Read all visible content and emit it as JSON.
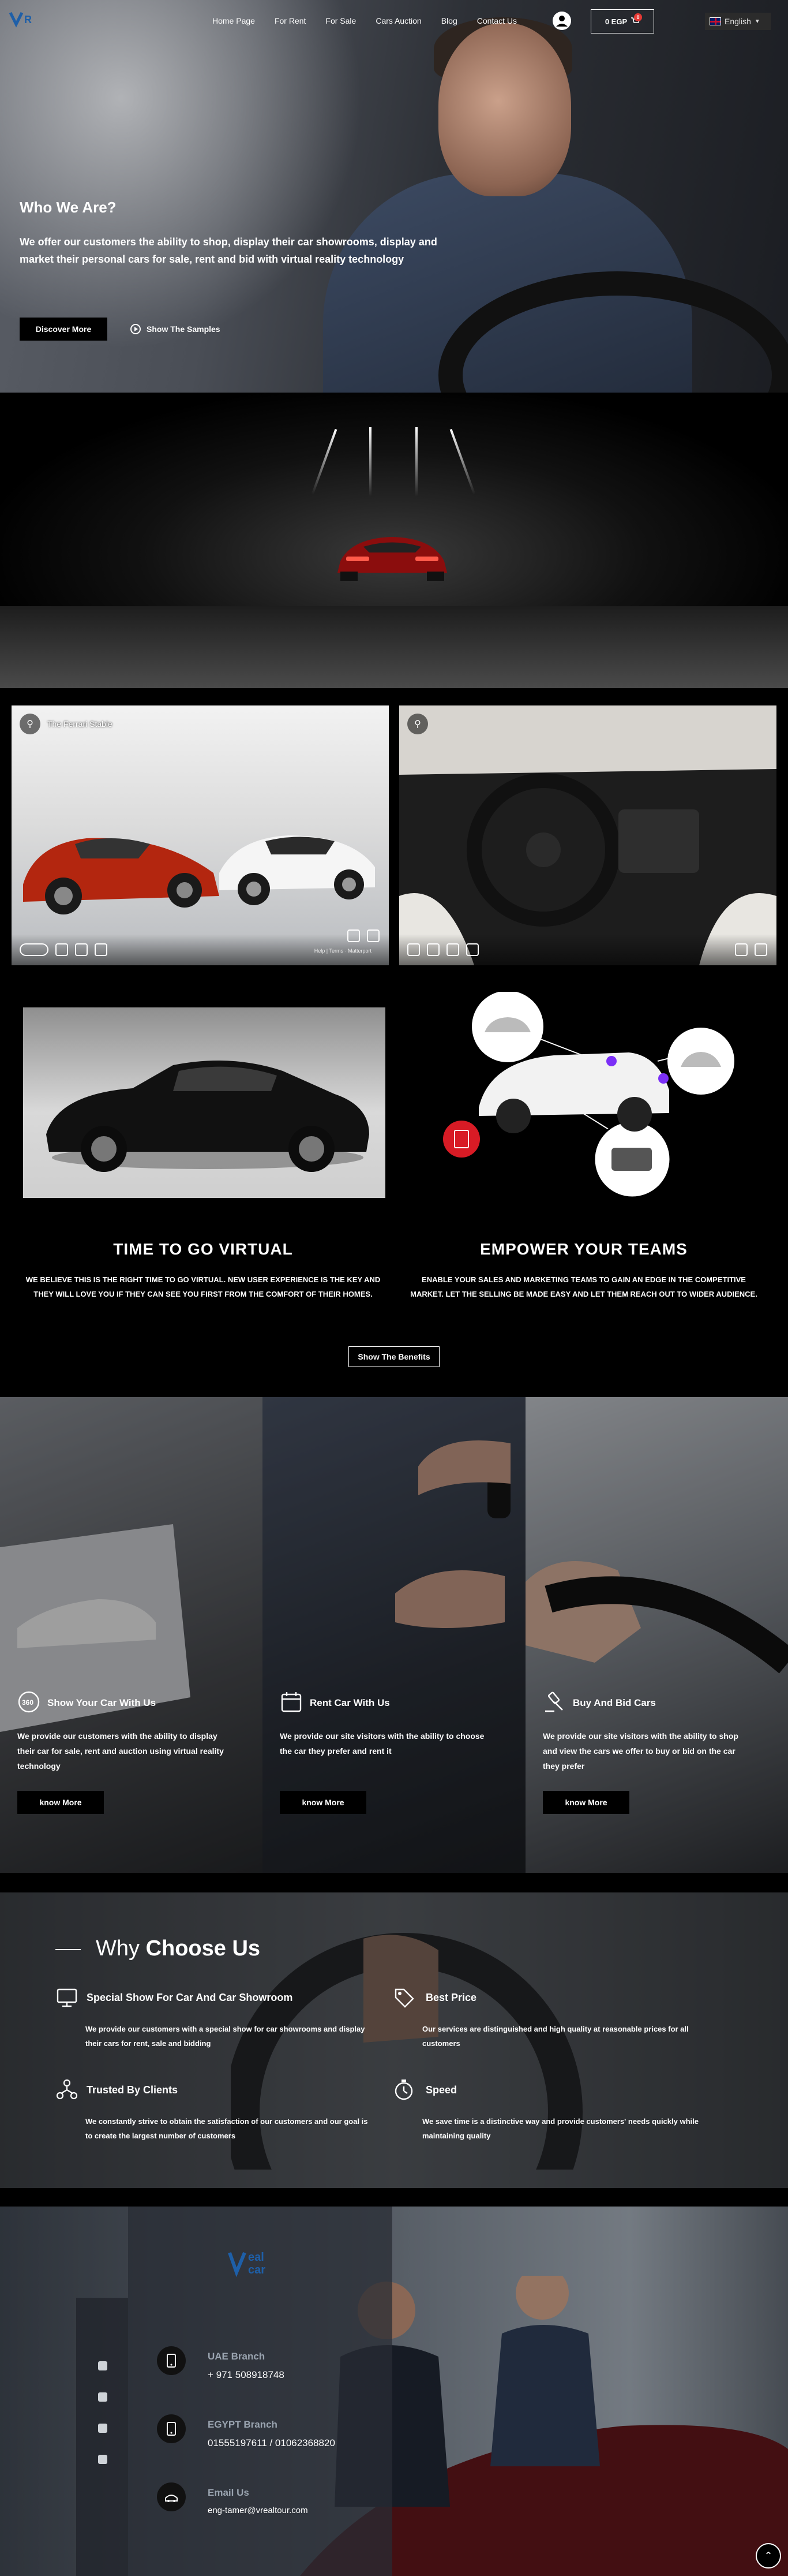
{
  "nav": {
    "links": [
      "Home Page",
      "For Rent",
      "For Sale",
      "Cars Auction",
      "Blog",
      "Contact Us"
    ],
    "cart_label": "0 EGP",
    "cart_count": "0",
    "language": "English"
  },
  "hero": {
    "title": "Who We Are?",
    "text": "We offer our customers the ability to shop, display their car showrooms, display and market their personal cars for sale, rent and bid with virtual reality technology",
    "discover_label": "Discover More",
    "samples_label": "Show The Samples"
  },
  "tours": [
    {
      "title": "The Ferrari Stable",
      "credit": "Help | Terms",
      "brand": "Matterport"
    },
    {
      "title": "",
      "credit": "",
      "brand": ""
    }
  ],
  "virtual": {
    "left_title": "TIME TO GO VIRTUAL",
    "left_text": "WE BELIEVE THIS IS THE RIGHT TIME TO GO VIRTUAL. NEW USER EXPERIENCE IS THE KEY AND THEY WILL LOVE YOU IF THEY CAN SEE YOU FIRST FROM THE COMFORT OF THEIR HOMES.",
    "right_title": "EMPOWER YOUR TEAMS",
    "right_text": "ENABLE YOUR SALES AND MARKETING TEAMS TO GAIN AN EDGE IN THE COMPETITIVE MARKET. LET THE SELLING BE MADE EASY AND LET THEM REACH OUT TO WIDER AUDIENCE.",
    "benefits_label": "Show The Benefits"
  },
  "services": [
    {
      "title": "Show Your Car With Us",
      "text": "We provide our customers with the ability to display their car for sale, rent and auction using virtual reality technology",
      "button": "know More",
      "icon": "360-icon"
    },
    {
      "title": "Rent Car With Us",
      "text": "We provide our site visitors with the ability to choose the car they prefer and rent it",
      "button": "know More",
      "icon": "calendar-icon"
    },
    {
      "title": "Buy And Bid Cars",
      "text": "We provide our site visitors with the ability to shop and view the cars we offer to buy or bid on the car they prefer",
      "button": "know More",
      "icon": "auction-icon"
    }
  ],
  "why": {
    "title_light": "Why ",
    "title_bold": "Choose Us",
    "items": [
      {
        "title": "Special Show For Car And Car Showroom",
        "text": "We provide our customers with a special show for car showrooms and display their cars for rent, sale and bidding"
      },
      {
        "title": "Best Price",
        "text": "Our services are distinguished and high quality at reasonable prices for all customers"
      },
      {
        "title": "Trusted By Clients",
        "text": "We constantly strive to obtain the satisfaction of our customers and our goal is to create the largest number of customers"
      },
      {
        "title": "Speed",
        "text": "We save time is a distinctive way and provide customers' needs quickly while maintaining quality"
      }
    ]
  },
  "contact": {
    "logo_text": "eal car",
    "items": [
      {
        "label": "UAE Branch",
        "value": "+ 971 508918748"
      },
      {
        "label": "EGYPT Branch",
        "value": "01555197611 / 01062368820"
      },
      {
        "label": "Email Us",
        "value": "eng-tamer@vrealtour.com"
      }
    ]
  },
  "colors": {
    "accent": "#1e5fa8",
    "badge": "#e53935",
    "purple": "#7b2ff7"
  }
}
